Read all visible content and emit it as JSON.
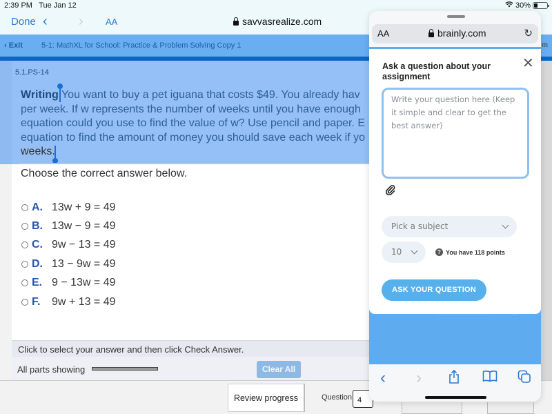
{
  "status_bar": {
    "time": "2:39 PM",
    "date": "Tue Jan 12",
    "battery_percent": "30%",
    "battery_level": 0.3,
    "wifi_icon": "wifi-icon"
  },
  "browser": {
    "done_label": "Done",
    "back_icon": "chevron-left-icon",
    "forward_icon": "chevron-right-icon",
    "text_size_label": "AA",
    "url": "savvasrealize.com",
    "lock_icon": "lock-icon"
  },
  "savvas_nav": {
    "exit_label": "Exit",
    "assignment_title": "5-1: MathXL for School: Practice & Problem Solving Copy 1",
    "right_fragment": "m"
  },
  "problem": {
    "id": "5.1.PS-14",
    "lead": "Writing",
    "lines": [
      " You want to buy a pet iguana that costs $49. You already hav",
      "per week. If w represents the number of weeks until you have enough",
      "equation could you use to find the value of w? Use pencil and paper. E",
      "equation to find the amount of money you should save each week if yo",
      "weeks."
    ],
    "prompt": "Choose the correct answer below.",
    "options": [
      {
        "letter": "A.",
        "equation": "13w + 9 = 49"
      },
      {
        "letter": "B.",
        "equation": "13w − 9 = 49"
      },
      {
        "letter": "C.",
        "equation": "9w − 13 = 49"
      },
      {
        "letter": "D.",
        "equation": "13 − 9w = 49"
      },
      {
        "letter": "E.",
        "equation": "9 − 13w = 49"
      },
      {
        "letter": "F.",
        "equation": "9w + 13 = 49"
      }
    ],
    "instruction": "Click to select your answer and then click Check Answer.",
    "parts_label": "All parts showing",
    "clear_all_label": "Clear All"
  },
  "footer": {
    "review_progress_label": "Review progress",
    "question_label": "Question",
    "question_number": "4"
  },
  "brainly": {
    "text_size_label": "AA",
    "url": "brainly.com",
    "reload_icon": "reload-icon",
    "modal_title": "Ask a question about your assignment",
    "close_icon": "close-icon",
    "question_placeholder": "Write your question here (Keep it simple and clear to get the best answer)",
    "attach_icon": "paperclip-icon",
    "subject_placeholder": "Pick a subject",
    "points_value": "10",
    "points_info": "You have 118 points",
    "ask_button_label": "ASK YOUR QUESTION",
    "background_button_label": "Ask your question",
    "toolbar_icons": [
      "back-icon",
      "forward-icon",
      "share-icon",
      "bookmarks-icon",
      "tabs-icon"
    ]
  }
}
